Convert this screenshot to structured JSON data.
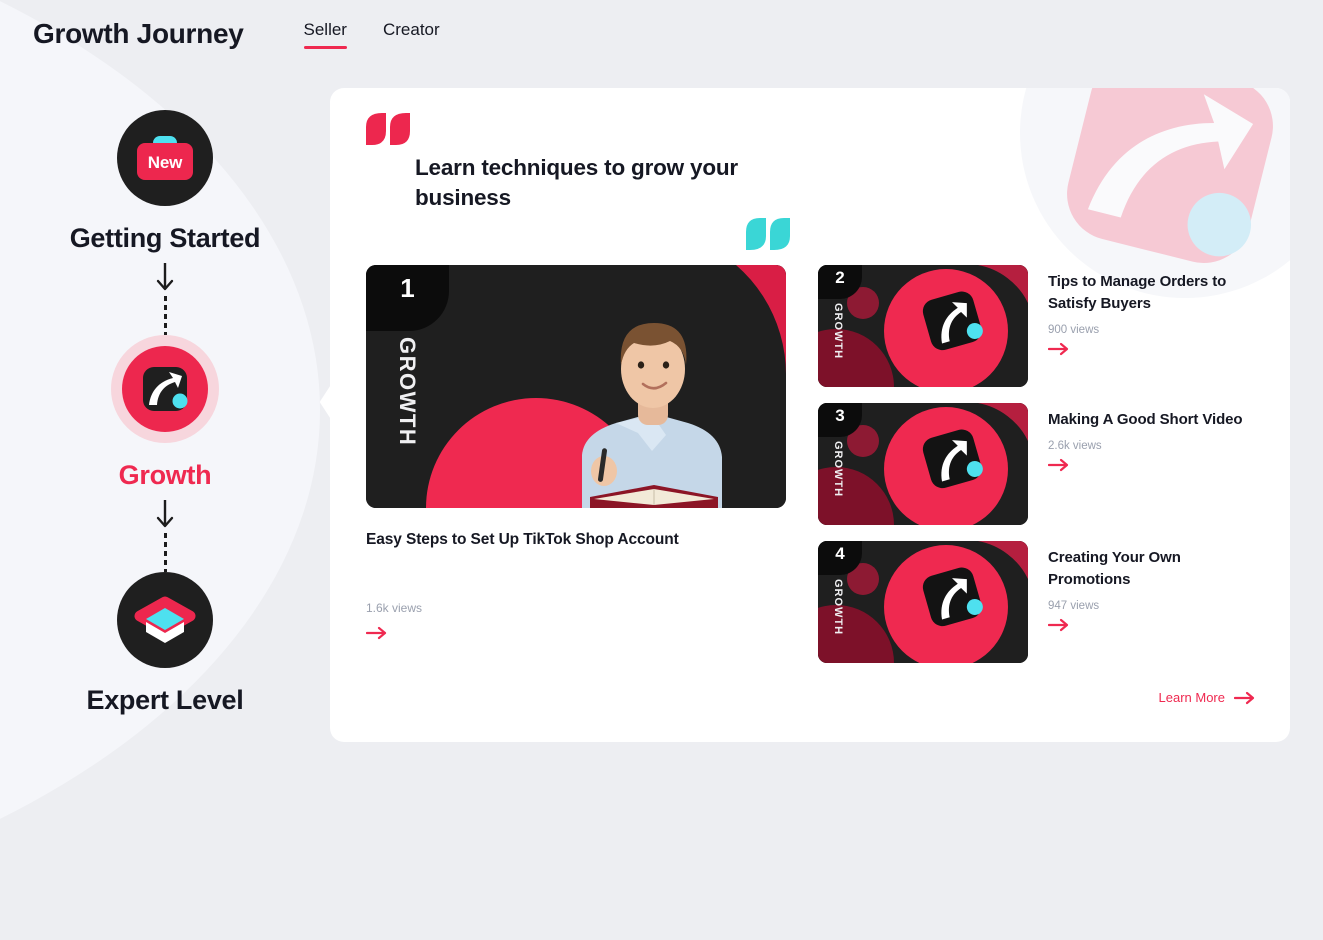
{
  "header": {
    "title": "Growth Journey",
    "tabs": [
      {
        "label": "Seller",
        "active": true
      },
      {
        "label": "Creator",
        "active": false
      }
    ]
  },
  "journey": {
    "steps": [
      {
        "label": "Getting Started",
        "icon": "new-briefcase-icon",
        "state": "complete",
        "badge_text": "New"
      },
      {
        "label": "Growth",
        "icon": "growth-arrow-icon",
        "state": "current"
      },
      {
        "label": "Expert Level",
        "icon": "layers-stack-icon",
        "state": "locked"
      }
    ]
  },
  "card": {
    "headline": "Learn techniques to grow your business",
    "quote_open": "“",
    "quote_close": "”",
    "featured": {
      "number": "1",
      "thumb_label": "GROWTH",
      "title": "Easy Steps to Set Up TikTok Shop Account",
      "views": "1.6k views"
    },
    "list": [
      {
        "number": "2",
        "thumb_label": "GROWTH",
        "title": "Tips to Manage Orders to Satisfy Buyers",
        "views": "900 views"
      },
      {
        "number": "3",
        "thumb_label": "GROWTH",
        "title": "Making A Good Short Video",
        "views": "2.6k views"
      },
      {
        "number": "4",
        "thumb_label": "GROWTH",
        "title": "Creating Your Own Promotions",
        "views": "947 views"
      }
    ],
    "learn_more": "Learn More"
  },
  "colors": {
    "accent_red": "#ef2950",
    "thumb_red": "#ed274e",
    "cyan": "#4ee0ef",
    "dark": "#161823",
    "page_bg": "#edeef2",
    "card_bg": "#ffffff",
    "muted_text": "#9aa0ae"
  }
}
